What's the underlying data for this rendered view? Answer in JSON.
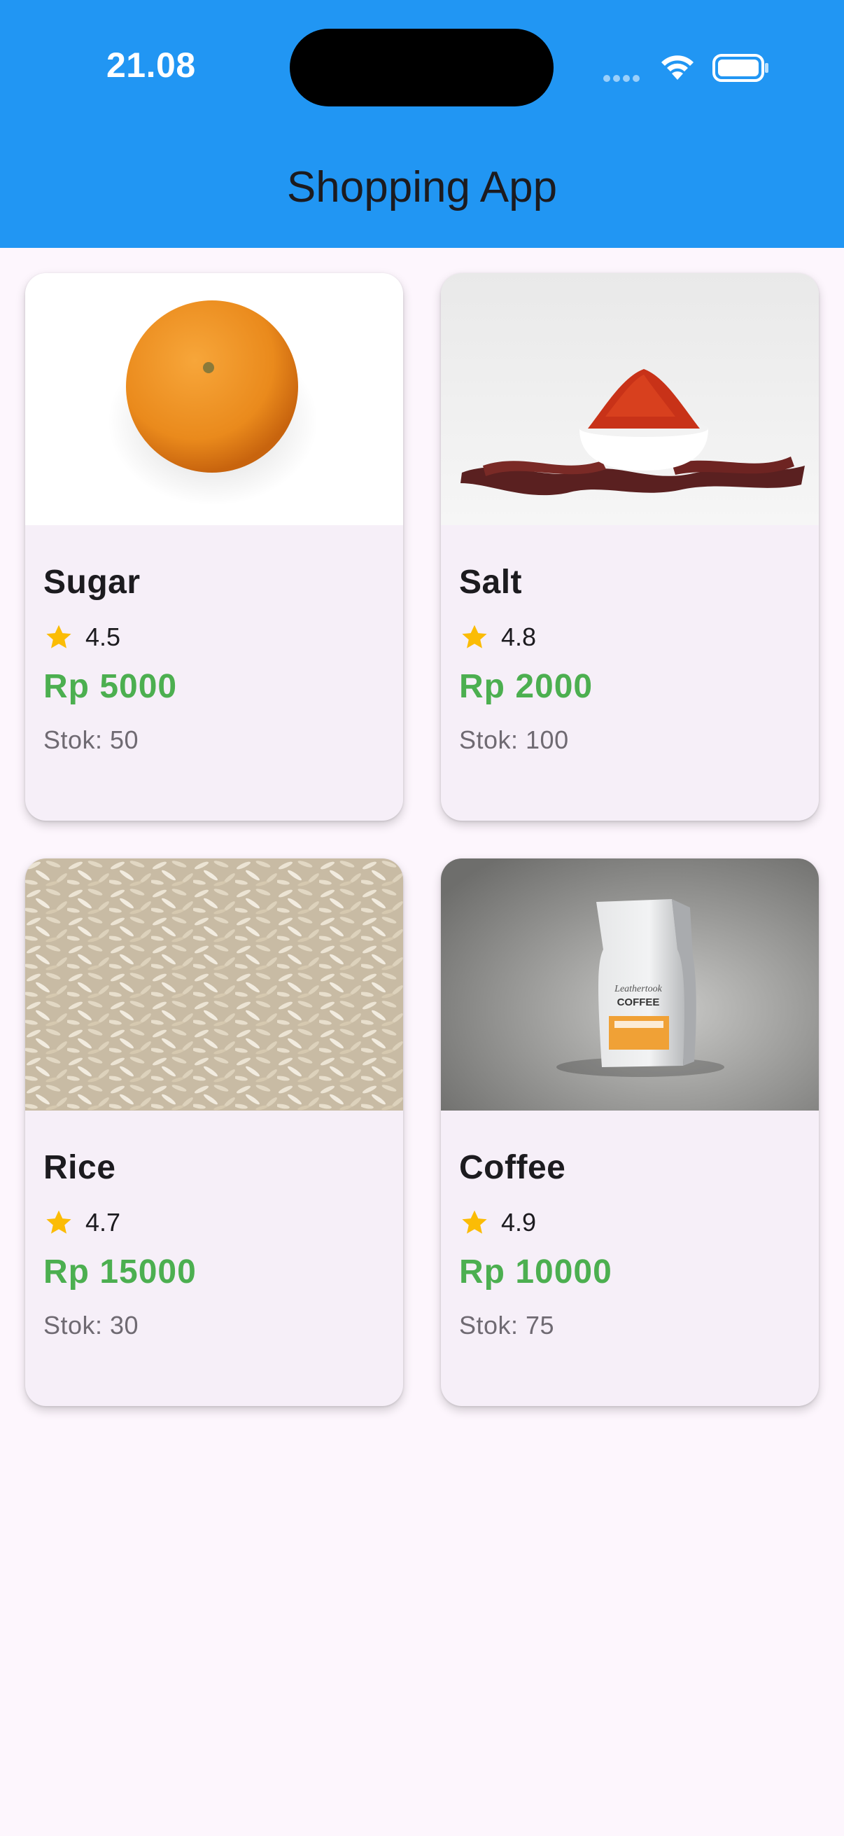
{
  "status_bar": {
    "time": "21.08"
  },
  "app_bar": {
    "title": "Shopping App",
    "color": "#2196f3"
  },
  "products": [
    {
      "name": "Sugar",
      "rating": "4.5",
      "price": "Rp 5000",
      "stock": "Stok: 50",
      "image": "orange-photo"
    },
    {
      "name": "Salt",
      "rating": "4.8",
      "price": "Rp 2000",
      "stock": "Stok: 100",
      "image": "chili-powder-photo"
    },
    {
      "name": "Rice",
      "rating": "4.7",
      "price": "Rp 15000",
      "stock": "Stok: 30",
      "image": "rice-grains-photo"
    },
    {
      "name": "Coffee",
      "rating": "4.9",
      "price": "Rp 10000",
      "stock": "Stok: 75",
      "image": "coffee-bag-photo"
    }
  ],
  "colors": {
    "price": "#4caf50",
    "star": "#fbbc05",
    "background": "#fdf6fd",
    "card": "#f6eff8"
  },
  "icons": [
    "wifi-icon",
    "battery-icon",
    "star-icon"
  ]
}
